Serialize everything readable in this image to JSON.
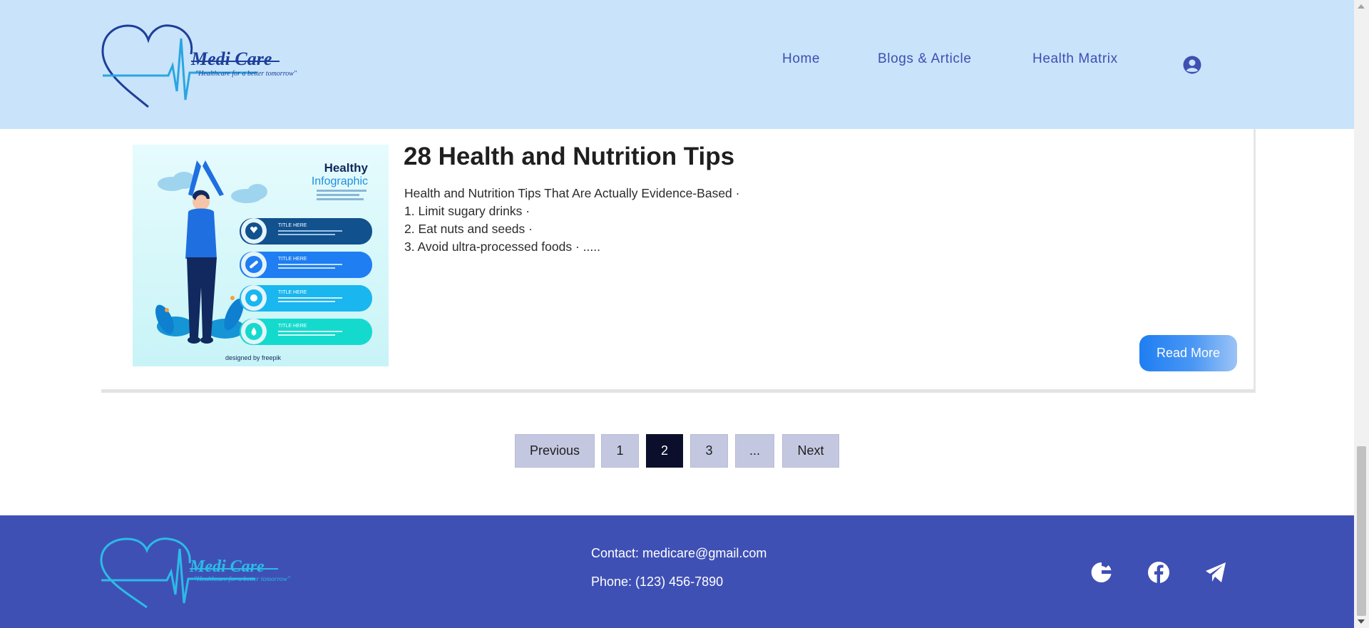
{
  "header": {
    "brand": "Medi Care",
    "tagline": "\"Healthcare for a better tomorrow\"",
    "nav": [
      {
        "label": "Home"
      },
      {
        "label": "Blogs & Article"
      },
      {
        "label": "Health Matrix"
      }
    ],
    "user_icon": "user-circle-icon"
  },
  "article": {
    "image": {
      "heading": "Healthy",
      "subheading": "Infographic",
      "item_label": "TITLE HERE",
      "credit": "designed by freepik"
    },
    "title": "28 Health and Nutrition Tips",
    "lines": [
      "Health and Nutrition Tips That Are Actually Evidence-Based ·",
      "1. Limit sugary drinks ·",
      "2. Eat nuts and seeds ·",
      "3. Avoid ultra-processed foods · ....."
    ],
    "read_more": "Read More"
  },
  "pagination": {
    "previous": "Previous",
    "pages": [
      "1",
      "2",
      "3",
      "..."
    ],
    "current": "2",
    "next": "Next"
  },
  "footer": {
    "brand": "Medi Care",
    "tagline": "\"Healthcare for a better tomorrow\"",
    "email": "Contact: medicare@gmail.com",
    "phone": "Phone: (123) 456-7890",
    "social": [
      "google-icon",
      "facebook-icon",
      "telegram-icon"
    ]
  },
  "colors": {
    "header_bg": "#c9e3fb",
    "footer_bg": "#3f50b5",
    "nav_text": "#3d4fb0",
    "button_blue": "#1f7ef2",
    "active_page": "#0b0f2b",
    "page_button": "#c4c7e0"
  }
}
